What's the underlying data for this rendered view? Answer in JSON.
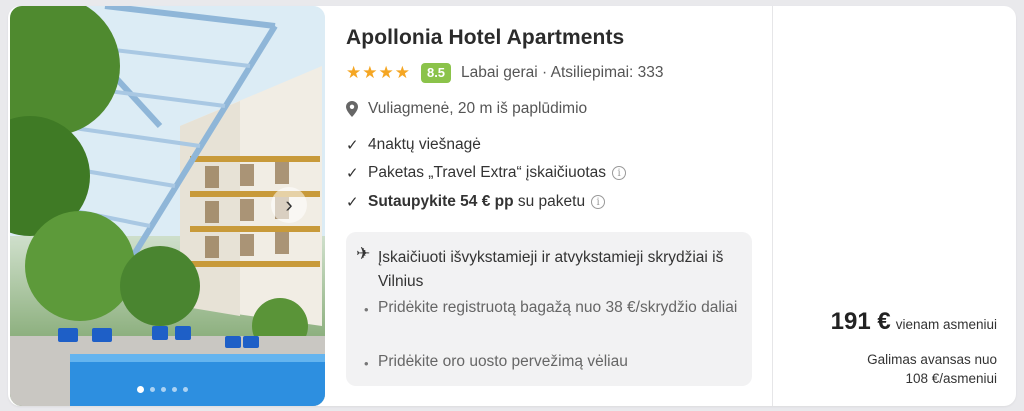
{
  "hotel": {
    "name": "Apollonia Hotel Apartments",
    "stars": "★★★★",
    "score": "8.5",
    "rating_text": "Labai gerai · Atsiliepimai: 333",
    "location": "Vuliagmenė, 20 m iš paplūdimio"
  },
  "features": {
    "nights": "4naktų viešnagė",
    "package": "Paketas „Travel Extra“ įskaičiuotas",
    "savings_bold": "Sutaupykite 54 € pp",
    "savings_rest": " su paketu"
  },
  "flights": {
    "included": "Įskaičiuoti išvykstamieji ir atvykstamieji skrydžiai iš Vilnius",
    "baggage": "Pridėkite registruotą bagažą nuo 38 €/skrydžio daliai",
    "transfer": "Pridėkite oro uosto pervežimą vėliau"
  },
  "price": {
    "amount": "191 €",
    "per": "vienam asmeniui",
    "deposit_line1": "Galimas avansas nuo",
    "deposit_line2": "108 €/asmeniui"
  },
  "gallery": {
    "next_glyph": "›",
    "dot_count": 5,
    "active_dot": 1
  },
  "colors": {
    "star": "#f5a623",
    "score_badge": "#8bc34a"
  }
}
